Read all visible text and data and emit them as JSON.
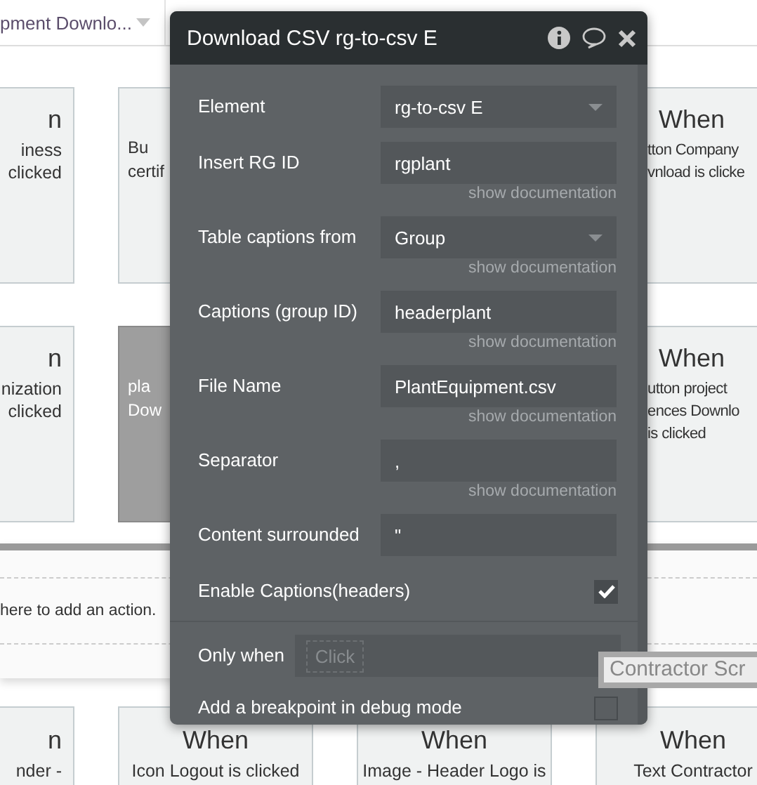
{
  "top_bar": {
    "dropdown": "pment Downlo..."
  },
  "event_rows": [
    {
      "cards": [
        {
          "kind": "cut_left",
          "heading": "n",
          "lines": [
            "iness",
            "clicked"
          ],
          "selected": false
        },
        {
          "kind": "cut_middle",
          "lines": [
            "Bu",
            "certif"
          ],
          "selected": false
        },
        {
          "kind": "hidden"
        },
        {
          "kind": "cut_right",
          "heading": "When",
          "lines": [
            "tton Company",
            "vnload is clicke"
          ],
          "selected": false
        }
      ]
    },
    {
      "cards": [
        {
          "kind": "cut_left",
          "heading": "n",
          "lines": [
            "nization",
            "clicked"
          ],
          "selected": false
        },
        {
          "kind": "cut_middle",
          "lines": [
            "pla",
            "Dow"
          ],
          "selected": true
        },
        {
          "kind": "hidden"
        },
        {
          "kind": "cut_right",
          "heading": "When",
          "lines": [
            "utton project",
            "ences Downlo",
            "is clicked"
          ],
          "selected": false
        }
      ]
    }
  ],
  "action_panel": {
    "hint": "here to add an action."
  },
  "bottom_row": {
    "cards": [
      {
        "kind": "cut_left",
        "heading": "n",
        "lines": [
          "nder -"
        ],
        "selected": false
      },
      {
        "kind": "full",
        "heading": "When",
        "lines": [
          "Icon Logout is clicked"
        ],
        "selected": false
      },
      {
        "kind": "full",
        "heading": "When",
        "lines": [
          "Image - Header Logo is"
        ],
        "selected": false
      },
      {
        "kind": "full",
        "heading": "When",
        "lines": [
          "Text Contractor"
        ],
        "selected": false
      }
    ]
  },
  "tooltip": "Contractor Scr",
  "dialog": {
    "title": "Download CSV rg-to-csv E",
    "fields": [
      {
        "kind": "dropdown",
        "label": "Element",
        "value": "rg-to-csv E"
      },
      {
        "kind": "text",
        "label": "Insert RG ID",
        "value": "rgplant",
        "doc": "show documentation"
      },
      {
        "kind": "dropdown",
        "label": "Table captions from",
        "value": "Group",
        "doc": "show documentation"
      },
      {
        "kind": "text",
        "label": "Captions (group ID)",
        "value": "headerplant",
        "doc": "show documentation"
      },
      {
        "kind": "text",
        "label": "File Name",
        "value": "PlantEquipment.csv",
        "doc": "show documentation"
      },
      {
        "kind": "text",
        "label": "Separator",
        "value": ",",
        "doc": "show documentation"
      },
      {
        "kind": "text",
        "label": "Content surrounded",
        "value": "\""
      },
      {
        "kind": "checkbox",
        "label": "Enable Captions(headers)",
        "checked": true
      }
    ],
    "only_when": {
      "label": "Only when",
      "placeholder": "Click"
    },
    "breakpoint": {
      "label": "Add a breakpoint in debug mode",
      "checked": false
    }
  }
}
